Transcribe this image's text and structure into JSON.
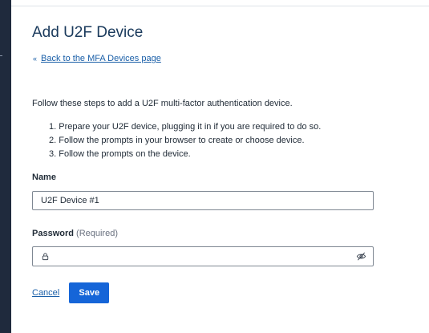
{
  "page": {
    "title": "Add U2F Device",
    "back_link_label": "Back to the MFA Devices page",
    "back_link_icon": "double-chevron-left-icon",
    "intro": "Follow these steps to add a U2F multi-factor authentication device.",
    "steps": [
      "1. Prepare your U2F device, plugging it in if you are required to do so.",
      "2. Follow the prompts in your browser to create or choose device.",
      "3. Follow the prompts on the device."
    ]
  },
  "form": {
    "name_label": "Name",
    "name_value": "U2F Device #1",
    "password_label": "Password",
    "password_hint": "(Required)",
    "password_value": "",
    "password_leading_icon": "lock-icon",
    "password_trailing_icon": "eye-slash-icon"
  },
  "actions": {
    "cancel_label": "Cancel",
    "save_label": "Save"
  },
  "colors": {
    "sidebar": "#1f2a3d",
    "title": "#1a3a5c",
    "link": "#1a5fa8",
    "primary_button": "#1565d8"
  }
}
